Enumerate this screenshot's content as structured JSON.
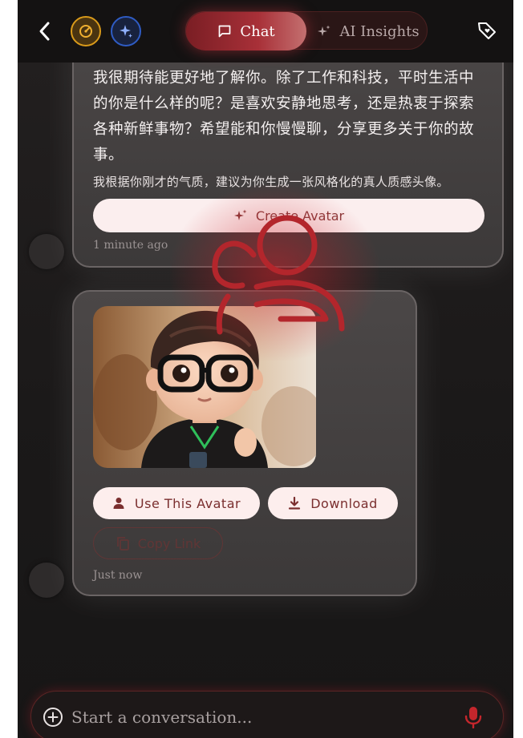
{
  "header": {
    "back_icon": "chevron-left-icon",
    "gauge_icon": "gauge-icon",
    "sparkle_icon": "sparkle-icon",
    "tabs": [
      {
        "label": "Chat",
        "icon": "chat-bubble-icon",
        "active": true
      },
      {
        "label": "AI Insights",
        "icon": "sparkles-icon",
        "active": false
      }
    ],
    "tag_icon": "tag-heart-icon"
  },
  "messages": [
    {
      "text": "我很期待能更好地了解你。除了工作和科技，平时生活中的你是什么样的呢？是喜欢安静地思考，还是热衷于探索各种新鲜事物？希望能和你慢慢聊，分享更多关于你的故事。",
      "sub": "我根据你刚才的气质，建议为你生成一张风格化的真人质感头像。",
      "button": "Create Avatar",
      "time": "1 minute ago"
    },
    {
      "image": "generated-3d-avatar-glasses",
      "use_button": "Use This Avatar",
      "download_button": "Download",
      "copy_button": "Copy Link",
      "time": "Just now"
    }
  ],
  "input": {
    "placeholder": "Start a conversation...",
    "plus_icon": "plus-circle-icon",
    "mic_icon": "microphone-icon"
  },
  "colors": {
    "accent": "#a83038",
    "gauge": "#d99a1a",
    "sparkle": "#2f5cc4",
    "button_bg": "#fdeeed",
    "button_text": "#7a2e2e"
  }
}
